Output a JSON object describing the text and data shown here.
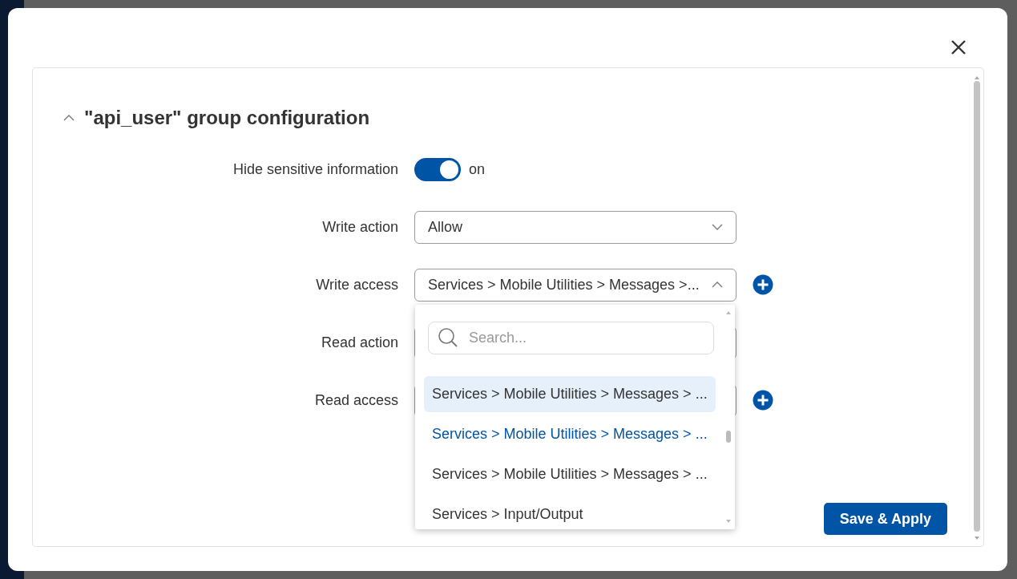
{
  "section": {
    "title": "\"api_user\" group configuration",
    "expanded": true
  },
  "fields": [
    {
      "kind": "toggle",
      "label": "Hide sensitive information",
      "on": true,
      "state_text": "on"
    },
    {
      "kind": "select",
      "label": "Write action",
      "value": "Allow",
      "open": false
    },
    {
      "kind": "select",
      "label": "Write access",
      "value": "Services > Mobile Utilities > Messages >...",
      "open": true,
      "addable": true,
      "dropdown": {
        "search_placeholder": "Search...",
        "options": [
          {
            "label": "Services > Mobile Utilities > Messages > ...",
            "selected": false,
            "highlighted": true
          },
          {
            "label": "Services > Mobile Utilities > Messages > ...",
            "selected": true,
            "highlighted": false
          },
          {
            "label": "Services > Mobile Utilities > Messages > ...",
            "selected": false,
            "highlighted": false
          },
          {
            "label": "Services > Input/Output",
            "selected": false,
            "highlighted": false
          }
        ]
      }
    },
    {
      "kind": "select",
      "label": "Read action"
    },
    {
      "kind": "select",
      "label": "Read access",
      "addable": true
    }
  ],
  "save_button": "Save & Apply"
}
